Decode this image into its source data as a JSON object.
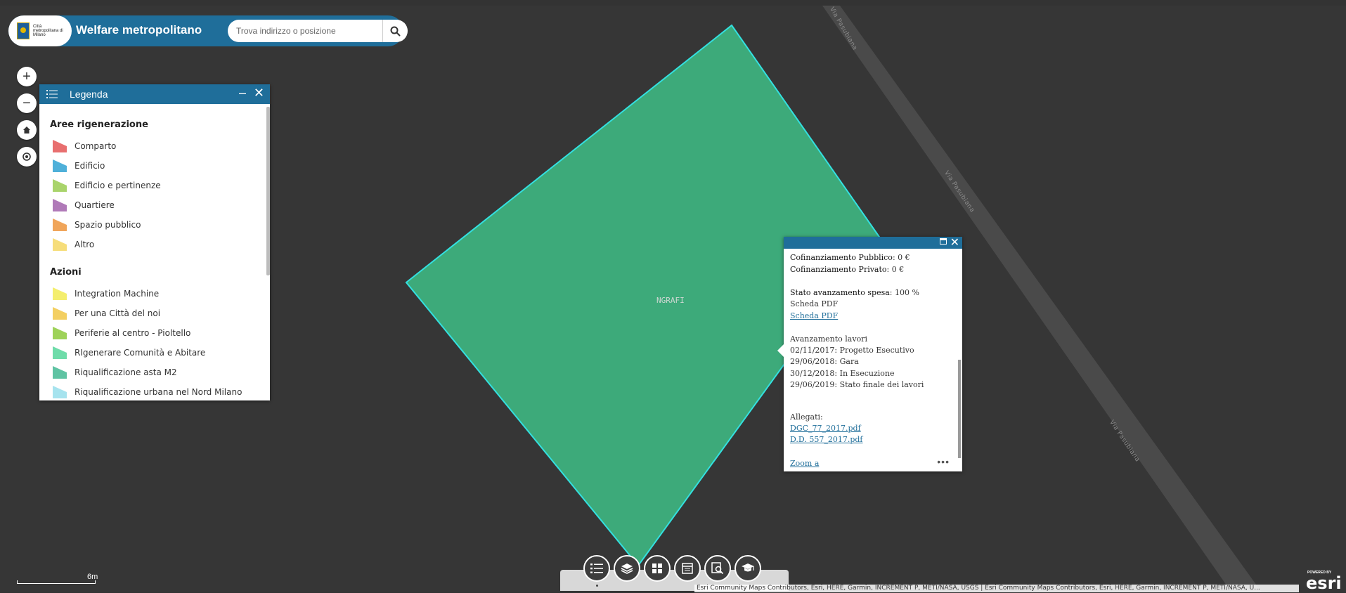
{
  "header": {
    "logo_text": "Città metropolitana di Milano",
    "title": "Welfare metropolitano",
    "search_placeholder": "Trova indirizzo o posizione"
  },
  "nav": {
    "zoom_in": "+",
    "zoom_out": "−"
  },
  "legend": {
    "title": "Legenda",
    "sections": [
      {
        "title": "Aree rigenerazione",
        "items": [
          {
            "label": "Comparto",
            "color": "#e86f6f"
          },
          {
            "label": "Edificio",
            "color": "#4fb0d9"
          },
          {
            "label": "Edificio e pertinenze",
            "color": "#a9d46b"
          },
          {
            "label": "Quartiere",
            "color": "#b07ab8"
          },
          {
            "label": "Spazio pubblico",
            "color": "#f0a55a"
          },
          {
            "label": "Altro",
            "color": "#f6dd7a"
          }
        ]
      },
      {
        "title": "Azioni",
        "items": [
          {
            "label": "Integration Machine",
            "color": "#f4ee6e"
          },
          {
            "label": "Per una Città del noi",
            "color": "#f3cf62"
          },
          {
            "label": "Periferie al centro - Pioltello",
            "color": "#9ed259"
          },
          {
            "label": "RIgenerare Comunità e Abitare",
            "color": "#6fdcaa"
          },
          {
            "label": "Riqualificazione asta M2",
            "color": "#5fc3a3"
          },
          {
            "label": "Riqualificazione urbana nel Nord Milano",
            "color": "#a6e3ee"
          }
        ]
      }
    ]
  },
  "popup": {
    "cof_pubblico_label": "Cofinanziamento Pubblico",
    "cof_pubblico_value": ": 0 €",
    "cof_privato_label": "Cofinanziamento Privato",
    "cof_privato_value": ": 0 €",
    "stato_label": "Stato avanzamento spesa",
    "stato_value": ": 100 %",
    "scheda_label": "Scheda PDF",
    "scheda_link": "Scheda PDF",
    "avanzamento_label": "Avanzamento lavori",
    "avanzamento": [
      "02/11/2017: Progetto Esecutivo",
      "29/06/2018: Gara",
      "30/12/2018: In Esecuzione",
      "29/06/2019: Stato finale dei lavori"
    ],
    "allegati_label": "Allegati:",
    "allegati": [
      "DGC_77_2017.pdf",
      "D.D. 557_2017.pdf"
    ],
    "zoom_link": "Zoom a",
    "more": "•••"
  },
  "map": {
    "parcel_label": "NGRAFI",
    "parcel_color": "#3daa7a",
    "parcel_outline": "#33e0e0",
    "road_labels": [
      "Via Pasubiana",
      "Via Pasubiana",
      "Via Pasubiana"
    ]
  },
  "scale": {
    "label": "6m"
  },
  "attribution": "Esri Community Maps Contributors, Esri, HERE, Garmin, INCREMENT P, METI/NASA, USGS | Esri Community Maps Contributors, Esri, HERE, Garmin, INCREMENT P, METI/NASA, U...",
  "esri": {
    "powered": "POWERED BY",
    "logo": "esri"
  }
}
